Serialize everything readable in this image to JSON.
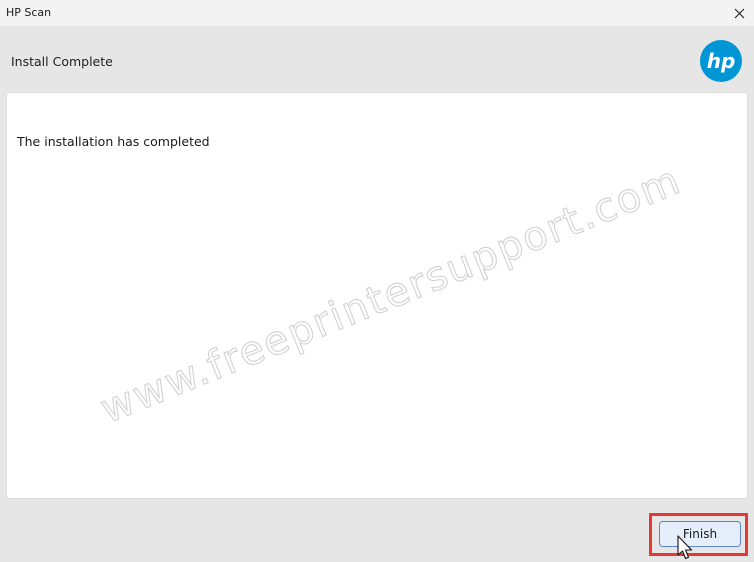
{
  "window": {
    "title": "HP Scan"
  },
  "header": {
    "heading": "Install Complete",
    "logo_text": "hp",
    "logo_color": "#0096d6"
  },
  "content": {
    "message": "The installation has completed"
  },
  "watermark": {
    "text": "www.freeprintersupport.com"
  },
  "footer": {
    "finish_label": "Finish",
    "highlight_color": "#e53935"
  }
}
